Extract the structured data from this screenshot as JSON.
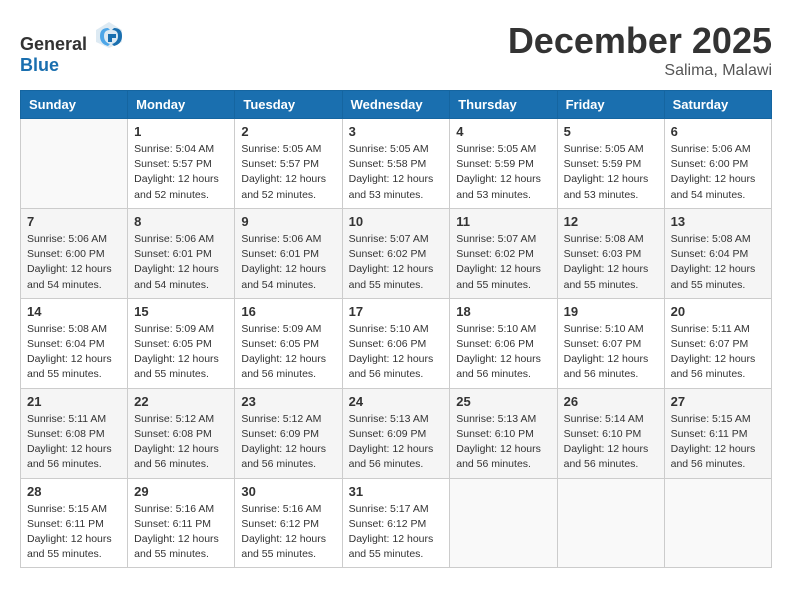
{
  "header": {
    "logo_general": "General",
    "logo_blue": "Blue",
    "month": "December 2025",
    "location": "Salima, Malawi"
  },
  "days_of_week": [
    "Sunday",
    "Monday",
    "Tuesday",
    "Wednesday",
    "Thursday",
    "Friday",
    "Saturday"
  ],
  "weeks": [
    [
      {
        "day": "",
        "info": ""
      },
      {
        "day": "1",
        "info": "Sunrise: 5:04 AM\nSunset: 5:57 PM\nDaylight: 12 hours\nand 52 minutes."
      },
      {
        "day": "2",
        "info": "Sunrise: 5:05 AM\nSunset: 5:57 PM\nDaylight: 12 hours\nand 52 minutes."
      },
      {
        "day": "3",
        "info": "Sunrise: 5:05 AM\nSunset: 5:58 PM\nDaylight: 12 hours\nand 53 minutes."
      },
      {
        "day": "4",
        "info": "Sunrise: 5:05 AM\nSunset: 5:59 PM\nDaylight: 12 hours\nand 53 minutes."
      },
      {
        "day": "5",
        "info": "Sunrise: 5:05 AM\nSunset: 5:59 PM\nDaylight: 12 hours\nand 53 minutes."
      },
      {
        "day": "6",
        "info": "Sunrise: 5:06 AM\nSunset: 6:00 PM\nDaylight: 12 hours\nand 54 minutes."
      }
    ],
    [
      {
        "day": "7",
        "info": "Sunrise: 5:06 AM\nSunset: 6:00 PM\nDaylight: 12 hours\nand 54 minutes."
      },
      {
        "day": "8",
        "info": "Sunrise: 5:06 AM\nSunset: 6:01 PM\nDaylight: 12 hours\nand 54 minutes."
      },
      {
        "day": "9",
        "info": "Sunrise: 5:06 AM\nSunset: 6:01 PM\nDaylight: 12 hours\nand 54 minutes."
      },
      {
        "day": "10",
        "info": "Sunrise: 5:07 AM\nSunset: 6:02 PM\nDaylight: 12 hours\nand 55 minutes."
      },
      {
        "day": "11",
        "info": "Sunrise: 5:07 AM\nSunset: 6:02 PM\nDaylight: 12 hours\nand 55 minutes."
      },
      {
        "day": "12",
        "info": "Sunrise: 5:08 AM\nSunset: 6:03 PM\nDaylight: 12 hours\nand 55 minutes."
      },
      {
        "day": "13",
        "info": "Sunrise: 5:08 AM\nSunset: 6:04 PM\nDaylight: 12 hours\nand 55 minutes."
      }
    ],
    [
      {
        "day": "14",
        "info": "Sunrise: 5:08 AM\nSunset: 6:04 PM\nDaylight: 12 hours\nand 55 minutes."
      },
      {
        "day": "15",
        "info": "Sunrise: 5:09 AM\nSunset: 6:05 PM\nDaylight: 12 hours\nand 55 minutes."
      },
      {
        "day": "16",
        "info": "Sunrise: 5:09 AM\nSunset: 6:05 PM\nDaylight: 12 hours\nand 56 minutes."
      },
      {
        "day": "17",
        "info": "Sunrise: 5:10 AM\nSunset: 6:06 PM\nDaylight: 12 hours\nand 56 minutes."
      },
      {
        "day": "18",
        "info": "Sunrise: 5:10 AM\nSunset: 6:06 PM\nDaylight: 12 hours\nand 56 minutes."
      },
      {
        "day": "19",
        "info": "Sunrise: 5:10 AM\nSunset: 6:07 PM\nDaylight: 12 hours\nand 56 minutes."
      },
      {
        "day": "20",
        "info": "Sunrise: 5:11 AM\nSunset: 6:07 PM\nDaylight: 12 hours\nand 56 minutes."
      }
    ],
    [
      {
        "day": "21",
        "info": "Sunrise: 5:11 AM\nSunset: 6:08 PM\nDaylight: 12 hours\nand 56 minutes."
      },
      {
        "day": "22",
        "info": "Sunrise: 5:12 AM\nSunset: 6:08 PM\nDaylight: 12 hours\nand 56 minutes."
      },
      {
        "day": "23",
        "info": "Sunrise: 5:12 AM\nSunset: 6:09 PM\nDaylight: 12 hours\nand 56 minutes."
      },
      {
        "day": "24",
        "info": "Sunrise: 5:13 AM\nSunset: 6:09 PM\nDaylight: 12 hours\nand 56 minutes."
      },
      {
        "day": "25",
        "info": "Sunrise: 5:13 AM\nSunset: 6:10 PM\nDaylight: 12 hours\nand 56 minutes."
      },
      {
        "day": "26",
        "info": "Sunrise: 5:14 AM\nSunset: 6:10 PM\nDaylight: 12 hours\nand 56 minutes."
      },
      {
        "day": "27",
        "info": "Sunrise: 5:15 AM\nSunset: 6:11 PM\nDaylight: 12 hours\nand 56 minutes."
      }
    ],
    [
      {
        "day": "28",
        "info": "Sunrise: 5:15 AM\nSunset: 6:11 PM\nDaylight: 12 hours\nand 55 minutes."
      },
      {
        "day": "29",
        "info": "Sunrise: 5:16 AM\nSunset: 6:11 PM\nDaylight: 12 hours\nand 55 minutes."
      },
      {
        "day": "30",
        "info": "Sunrise: 5:16 AM\nSunset: 6:12 PM\nDaylight: 12 hours\nand 55 minutes."
      },
      {
        "day": "31",
        "info": "Sunrise: 5:17 AM\nSunset: 6:12 PM\nDaylight: 12 hours\nand 55 minutes."
      },
      {
        "day": "",
        "info": ""
      },
      {
        "day": "",
        "info": ""
      },
      {
        "day": "",
        "info": ""
      }
    ]
  ]
}
